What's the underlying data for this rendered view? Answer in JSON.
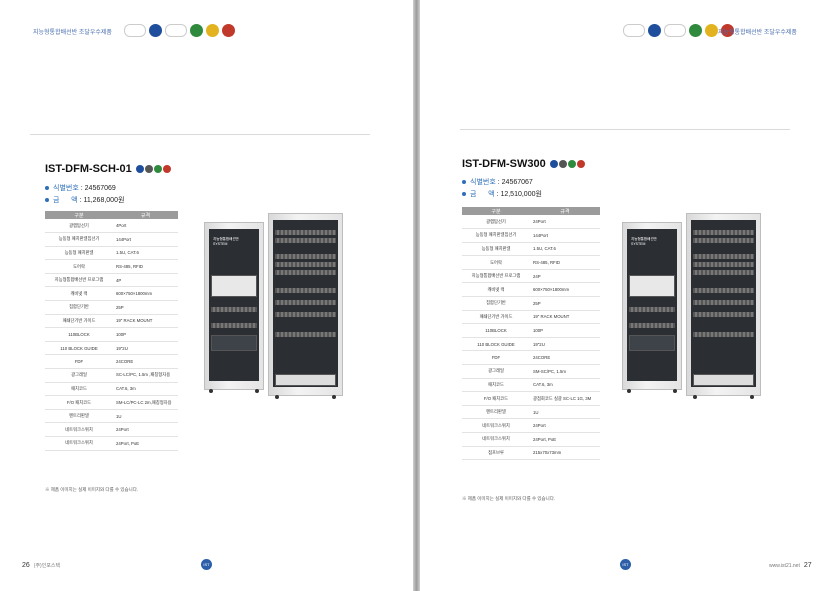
{
  "header": {
    "catalog_title": "지능형통합배선반 조달우수제품"
  },
  "logos": [
    "조달우수제품",
    "GS",
    "조달청우수제품",
    "NEP",
    "성능인증",
    "Q"
  ],
  "left": {
    "product": {
      "model": "IST-DFM-SCH-01",
      "id_label": "식별번호",
      "id_value": ": 24567069",
      "price_label": "금      액",
      "price_value": ": 11,268,000원"
    },
    "table": {
      "headers": [
        "구분",
        "규격"
      ],
      "rows": [
        [
          "광랩탑선기",
          "4Port"
        ],
        [
          "능동형 패치판넬집선기",
          "144Port"
        ],
        [
          "능동형 패치판넬",
          "1.5U, CAT.6"
        ],
        [
          "도어락",
          "RS-485, RFID"
        ],
        [
          "지능형통합배선반 프로그램",
          "4P"
        ],
        [
          "캐비넷 랙",
          "600×750×1800mm"
        ],
        [
          "집합단기반",
          "25P"
        ],
        [
          "패쇄단기반 가이드",
          "19\" RACK MOUNT"
        ],
        [
          "110BLOCK",
          "100P"
        ],
        [
          "110 BLOCK GUIDE",
          "19\"2U"
        ],
        [
          "FDF",
          "24CORE"
        ],
        [
          "광그레일",
          "SC-LC/PC, 1.5m ,패칭형자용"
        ],
        [
          "패치코드",
          "CAT.6, 3m"
        ],
        [
          "F/O 패치코드",
          "SM-LC/PC-LC 2m,패칭형자용"
        ],
        [
          "멘트리판넬",
          "1U"
        ],
        [
          "네트워크스위치",
          "24Port"
        ],
        [
          "네트워크스위치",
          "24Port, PoE"
        ]
      ]
    },
    "note": "※ 제품 이미지는 실제 이미지와 다를 수 있습니다.",
    "page_number": "26",
    "company": "(주)인포스텍"
  },
  "right": {
    "product": {
      "model": "IST-DFM-SW300",
      "id_label": "식별번호",
      "id_value": ": 24567067",
      "price_label": "금      액",
      "price_value": ": 12,510,000원"
    },
    "table": {
      "headers": [
        "구분",
        "규격"
      ],
      "rows": [
        [
          "광랩탑선기",
          "24Port"
        ],
        [
          "능동형 패치판넬집선기",
          "144Port"
        ],
        [
          "능동형 패치판넬",
          "1.5U, CAT.6"
        ],
        [
          "도어락",
          "RS-485, RFID"
        ],
        [
          "지능형통합배선반 프로그램",
          "24P"
        ],
        [
          "캐비넷 랙",
          "600×750×1800mm"
        ],
        [
          "집합단기반",
          "25P"
        ],
        [
          "패쇄단기반 가이드",
          "19\" RACK MOUNT"
        ],
        [
          "110BLOCK",
          "100P"
        ],
        [
          "110 BLOCK GUIDE",
          "19\"2U"
        ],
        [
          "FDF",
          "24CORE"
        ],
        [
          "광그레일",
          "SM-SC/PC, 1.5m"
        ],
        [
          "패치코드",
          "CAT.6, 3m"
        ],
        [
          "F/O 패치코드",
          "광점회코드 실광 SC-LC 1G, 3M"
        ],
        [
          "멘트리판넬",
          "1U"
        ],
        [
          "네트워크스위치",
          "24Port"
        ],
        [
          "네트워크스위치",
          "24Port, PoE"
        ],
        [
          "점프브루",
          "215x70x73mm"
        ]
      ]
    },
    "note": "※ 제품 이미지는 실제 이미지와 다를 수 있습니다.",
    "page_number": "27",
    "website": "www.ist21.net"
  },
  "cabinet_label": {
    "line1": "지능형통합배선반",
    "line2": "SYSTEM"
  },
  "brand_mark": "IST",
  "colors": {
    "accent": "#2e6fb8",
    "table_header": "#9b9b9b",
    "header_text": "#4a6fb0"
  }
}
